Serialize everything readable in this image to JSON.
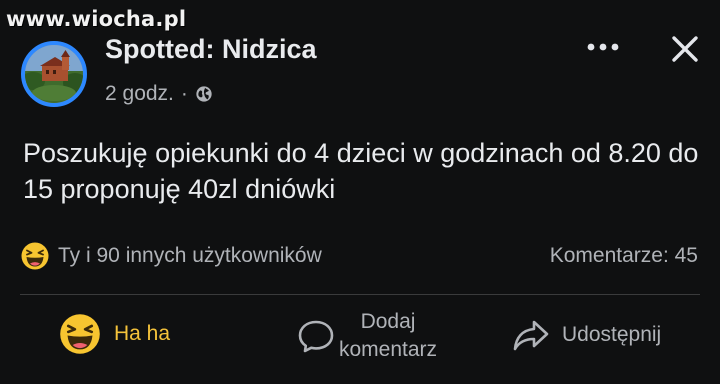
{
  "watermark": "www.wiocha.pl",
  "post": {
    "page_name": "Spotted: Nidzica",
    "time": "2 godz.",
    "separator": "·",
    "audience_icon": "globe-icon",
    "text": "Poszukuję opiekunki do 4 dzieci w godzinach od 8.20 do 15 proponuję 40zl dniówki"
  },
  "header_actions": {
    "more_icon": "more-horizontal-icon",
    "close_icon": "close-icon"
  },
  "reactions": {
    "emoji": "haha-emoji-icon",
    "summary": "Ty i 90 innych użytkowników",
    "comments": "Komentarze: 45"
  },
  "actions": {
    "haha_label": "Ha ha",
    "comment_label": "Dodaj\nkomentarz",
    "share_label": "Udostępnij"
  },
  "colors": {
    "background": "#0f1011",
    "text_primary": "#e9ebee",
    "text_secondary": "#b0b3b8",
    "haha_active": "#f5c33b",
    "avatar_ring": "#2d88ff",
    "divider": "#3a3b3c"
  }
}
